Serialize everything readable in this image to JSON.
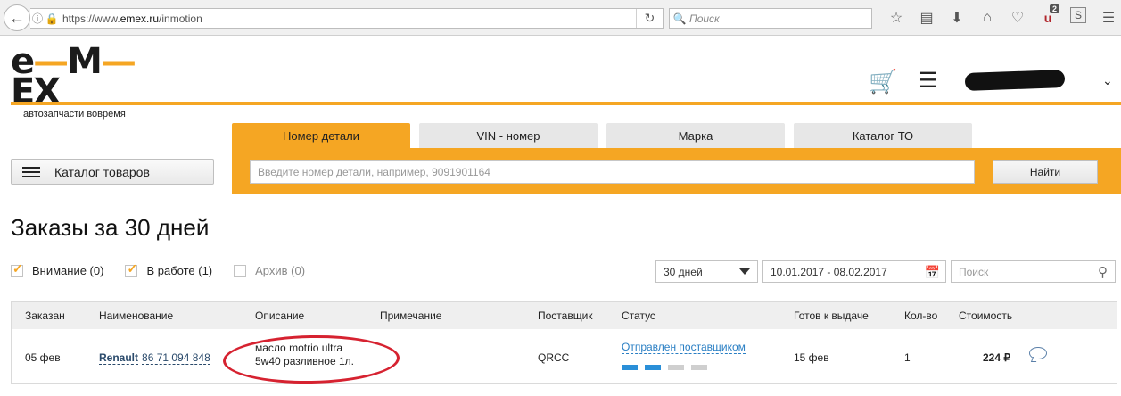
{
  "browser": {
    "url_host": "https://www.",
    "url_domain": "emex.ru",
    "url_path": "/inmotion",
    "search_placeholder": "Поиск",
    "addon_badge": "2"
  },
  "header": {
    "logo_text_1": "e",
    "logo_text_2": "M",
    "logo_text_3": "EX",
    "tagline": "автозапчасти вовремя"
  },
  "catalog_button": {
    "label": "Каталог товаров"
  },
  "search": {
    "tabs": [
      {
        "label": "Номер детали",
        "active": true
      },
      {
        "label": "VIN - номер",
        "active": false
      },
      {
        "label": "Марка",
        "active": false
      },
      {
        "label": "Каталог ТО",
        "active": false
      }
    ],
    "input_placeholder": "Введите номер детали, например, 9091901164",
    "find_label": "Найти"
  },
  "page": {
    "title": "Заказы за 30 дней"
  },
  "filters": {
    "attention": {
      "label": "Внимание (0)",
      "checked": true
    },
    "in_work": {
      "label": "В работе (1)",
      "checked": true
    },
    "archive": {
      "label": "Архив (0)",
      "checked": false
    },
    "period": "30 дней",
    "date_range": "10.01.2017 - 08.02.2017",
    "search_placeholder": "Поиск"
  },
  "table": {
    "headers": {
      "ordered": "Заказан",
      "name": "Наименование",
      "description": "Описание",
      "note": "Примечание",
      "supplier": "Поставщик",
      "status": "Статус",
      "ready": "Готов к выдаче",
      "qty": "Кол-во",
      "cost": "Стоимость"
    },
    "rows": [
      {
        "ordered": "05 фев",
        "brand": "Renault",
        "part_number": "86 71 094 848",
        "description_line1": "масло motrio ultra",
        "description_line2": "5w40 разливное 1л.",
        "note": "",
        "supplier": "QRCC",
        "status": "Отправлен поставщиком",
        "status_steps_done": 2,
        "status_steps_total": 4,
        "ready": "15 фев",
        "qty": "1",
        "cost": "224 ₽"
      }
    ]
  },
  "colors": {
    "accent": "#f5a623",
    "link": "#2a7fc4",
    "annotation": "#d62230"
  }
}
